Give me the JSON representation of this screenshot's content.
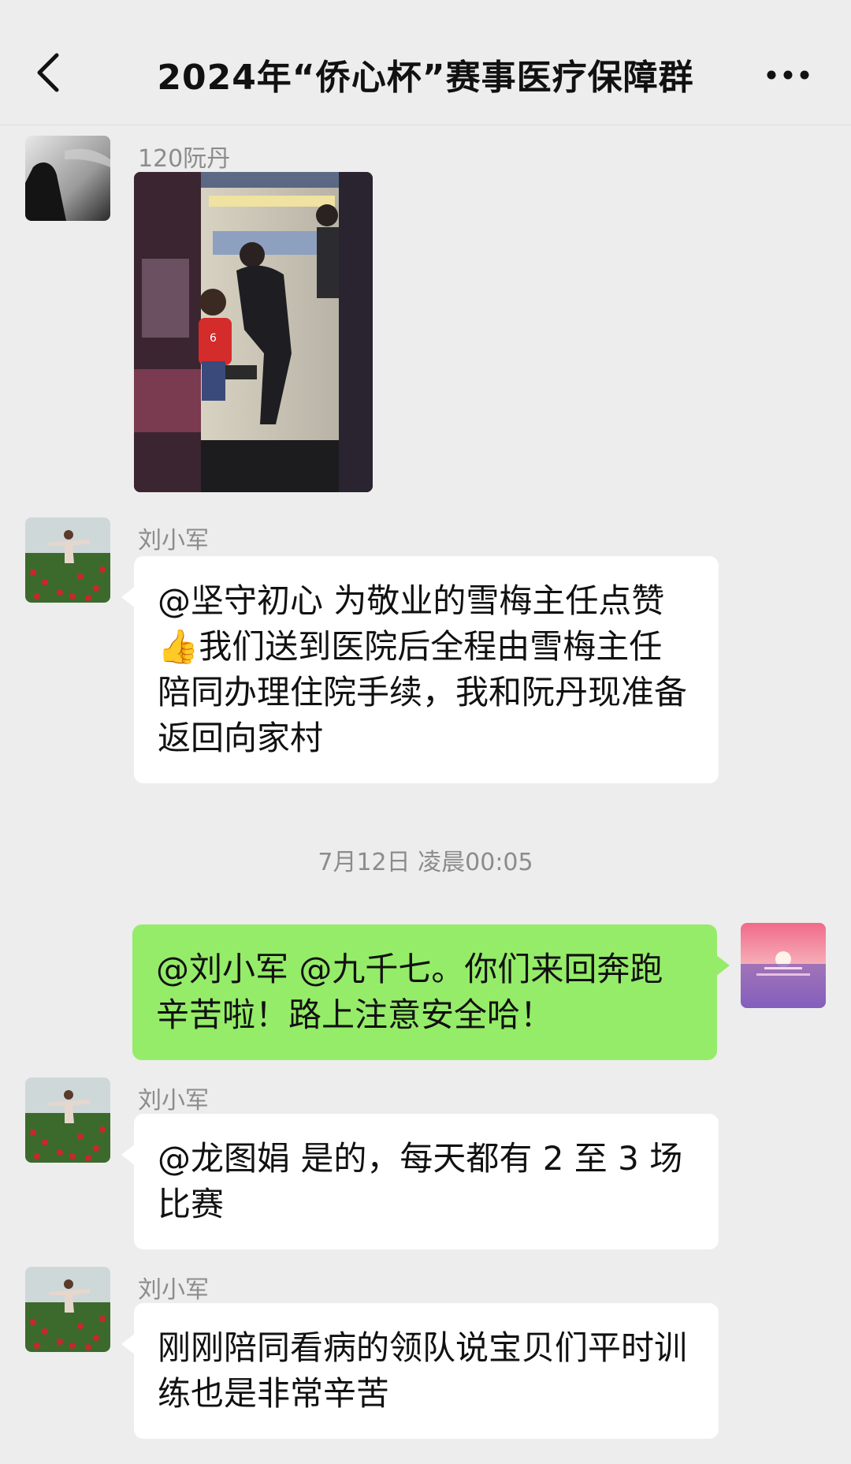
{
  "header": {
    "title": "2024年“侨心杯”赛事医疗保障群",
    "back_icon": "chevron-left-icon",
    "more_icon": "more-dots-icon"
  },
  "messages": [
    {
      "sender": "120阮丹",
      "type": "image",
      "image_desc": "photo"
    },
    {
      "sender": "刘小军",
      "type": "text",
      "text": "@坚守初心  为敬业的雪梅主任点赞👍我们送到医院后全程由雪梅主任陪同办理住院手续，我和阮丹现准备返回向家村"
    },
    {
      "timestamp": "7月12日 凌晨00:05"
    },
    {
      "sender": "me",
      "type": "text",
      "text": "@刘小军  @九千七。你们来回奔跑  辛苦啦！路上注意安全哈！"
    },
    {
      "sender": "刘小军",
      "type": "text",
      "text": "@龙图娟  是的，每天都有 2 至 3 场比赛"
    },
    {
      "sender": "刘小军",
      "type": "text",
      "text": "刚刚陪同看病的领队说宝贝们平时训练也是非常辛苦"
    }
  ],
  "colors": {
    "background": "#ededed",
    "bubble_self": "#95ec69",
    "bubble_other": "#ffffff",
    "meta_text": "#8c8c8c"
  }
}
